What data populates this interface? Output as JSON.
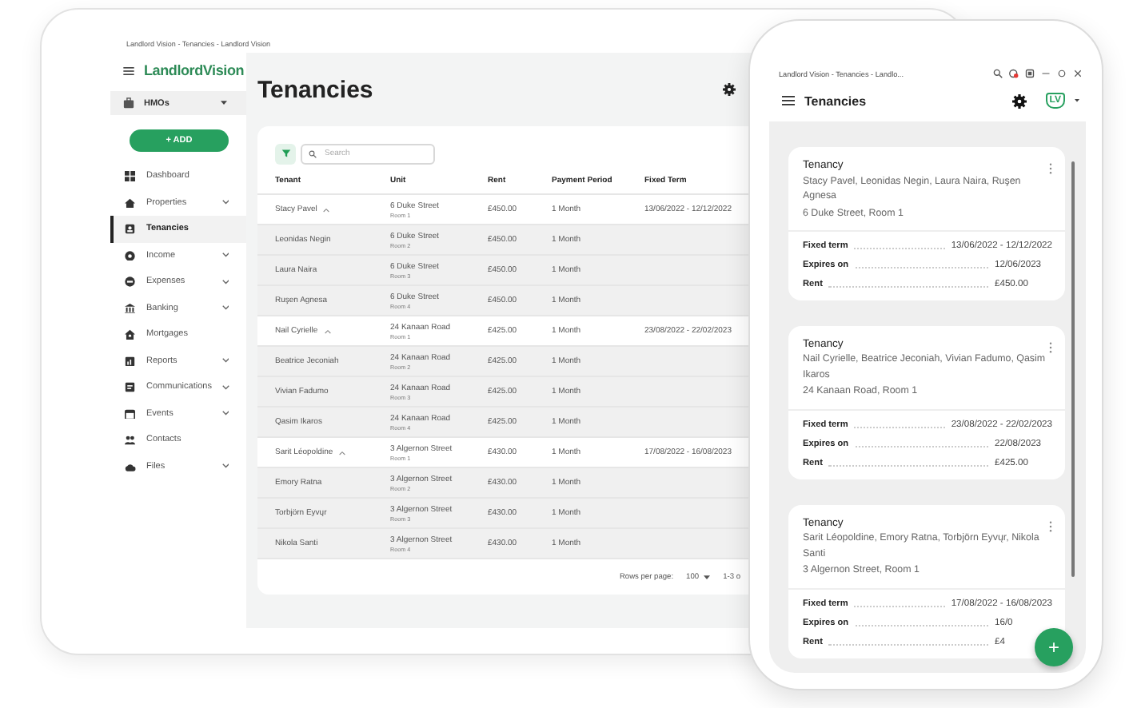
{
  "tablet": {
    "window_title": "Landlord Vision - Tenancies - Landlord Vision",
    "brand": "LandlordVision",
    "portfolio": "HMOs",
    "add_button": "+ ADD",
    "nav": [
      {
        "label": "Dashboard",
        "expandable": false,
        "selected": false
      },
      {
        "label": "Properties",
        "expandable": true,
        "selected": false
      },
      {
        "label": "Tenancies",
        "expandable": false,
        "selected": true
      },
      {
        "label": "Income",
        "expandable": true,
        "selected": false
      },
      {
        "label": "Expenses",
        "expandable": true,
        "selected": false
      },
      {
        "label": "Banking",
        "expandable": true,
        "selected": false
      },
      {
        "label": "Mortgages",
        "expandable": false,
        "selected": false
      },
      {
        "label": "Reports",
        "expandable": true,
        "selected": false
      },
      {
        "label": "Communications",
        "expandable": true,
        "selected": false
      },
      {
        "label": "Events",
        "expandable": true,
        "selected": false
      },
      {
        "label": "Contacts",
        "expandable": false,
        "selected": false
      },
      {
        "label": "Files",
        "expandable": true,
        "selected": false
      }
    ],
    "page_title": "Tenancies",
    "search": {
      "placeholder": "Search"
    },
    "columns": [
      "Tenant",
      "Unit",
      "Rent",
      "Payment Period",
      "Fixed Term"
    ],
    "rows": [
      {
        "kind": "group",
        "expanded": true,
        "tenant": "Stacy Pavel",
        "unit": "6 Duke Street",
        "room": "Room 1",
        "rent": "£450.00",
        "period": "1 Month",
        "fixed_term": "13/06/2022 - 12/12/2022"
      },
      {
        "kind": "member",
        "tenant": "Leonidas Negin",
        "unit": "6 Duke Street",
        "room": "Room 2",
        "rent": "£450.00",
        "period": "1 Month"
      },
      {
        "kind": "member",
        "tenant": "Laura Naira",
        "unit": "6 Duke Street",
        "room": "Room 3",
        "rent": "£450.00",
        "period": "1 Month"
      },
      {
        "kind": "member",
        "tenant": "Ruşen Agnesa",
        "unit": "6 Duke Street",
        "room": "Room 4",
        "rent": "£450.00",
        "period": "1 Month"
      },
      {
        "kind": "group",
        "expanded": true,
        "tenant": "Nail Cyrielle",
        "unit": "24 Kanaan Road",
        "room": "Room 1",
        "rent": "£425.00",
        "period": "1 Month",
        "fixed_term": "23/08/2022 - 22/02/2023"
      },
      {
        "kind": "member",
        "tenant": "Beatrice Jeconiah",
        "unit": "24 Kanaan Road",
        "room": "Room 2",
        "rent": "£425.00",
        "period": "1 Month"
      },
      {
        "kind": "member",
        "tenant": "Vivian Fadumo",
        "unit": "24 Kanaan Road",
        "room": "Room 3",
        "rent": "£425.00",
        "period": "1 Month"
      },
      {
        "kind": "member",
        "tenant": "Qasim Ikaros",
        "unit": "24 Kanaan Road",
        "room": "Room 4",
        "rent": "£425.00",
        "period": "1 Month"
      },
      {
        "kind": "group",
        "expanded": true,
        "tenant": "Sarit Léopoldine",
        "unit": "3 Algernon Street",
        "room": "Room 1",
        "rent": "£430.00",
        "period": "1 Month",
        "fixed_term": "17/08/2022 - 16/08/2023"
      },
      {
        "kind": "member",
        "tenant": "Emory Ratna",
        "unit": "3 Algernon Street",
        "room": "Room 2",
        "rent": "£430.00",
        "period": "1 Month"
      },
      {
        "kind": "member",
        "tenant": "Torbjörn Eyvųr",
        "unit": "3 Algernon Street",
        "room": "Room 3",
        "rent": "£430.00",
        "period": "1 Month"
      },
      {
        "kind": "member",
        "tenant": "Nikola Santi",
        "unit": "3 Algernon Street",
        "room": "Room 4",
        "rent": "£430.00",
        "period": "1 Month"
      }
    ],
    "rows_per_page_label": "Rows per page:",
    "rows_per_page": "100",
    "range": "1-3 o"
  },
  "phone": {
    "window_title": "Landlord Vision - Tenancies - Landlo...",
    "title": "Tenancies",
    "avatar": "LV",
    "fab": "+",
    "cards": [
      {
        "title": "Tenancy",
        "tenants": "Stacy Pavel, Leonidas Negin, Laura Naira, Ruşen Agnesa",
        "address": "6 Duke Street, Room 1",
        "details": [
          {
            "label": "Fixed term",
            "value": "13/06/2022 - 12/12/2022"
          },
          {
            "label": "Expires on",
            "value": "12/06/2023"
          },
          {
            "label": "Rent",
            "value": "£450.00"
          }
        ]
      },
      {
        "title": "Tenancy",
        "tenants": "Nail Cyrielle, Beatrice Jeconiah, Vivian Fadumo, Qasim Ikaros",
        "address": "24 Kanaan Road, Room 1",
        "details": [
          {
            "label": "Fixed term",
            "value": "23/08/2022 - 22/02/2023"
          },
          {
            "label": "Expires on",
            "value": "22/08/2023"
          },
          {
            "label": "Rent",
            "value": "£425.00"
          }
        ]
      },
      {
        "title": "Tenancy",
        "tenants": "Sarit Léopoldine, Emory Ratna, Torbjörn Eyvųr, Nikola Santi",
        "address": "3 Algernon Street, Room 1",
        "details": [
          {
            "label": "Fixed term",
            "value": "17/08/2022 - 16/08/2023"
          },
          {
            "label": "Expires on",
            "value": "16/0"
          },
          {
            "label": "Rent",
            "value": "£4"
          }
        ]
      }
    ]
  }
}
